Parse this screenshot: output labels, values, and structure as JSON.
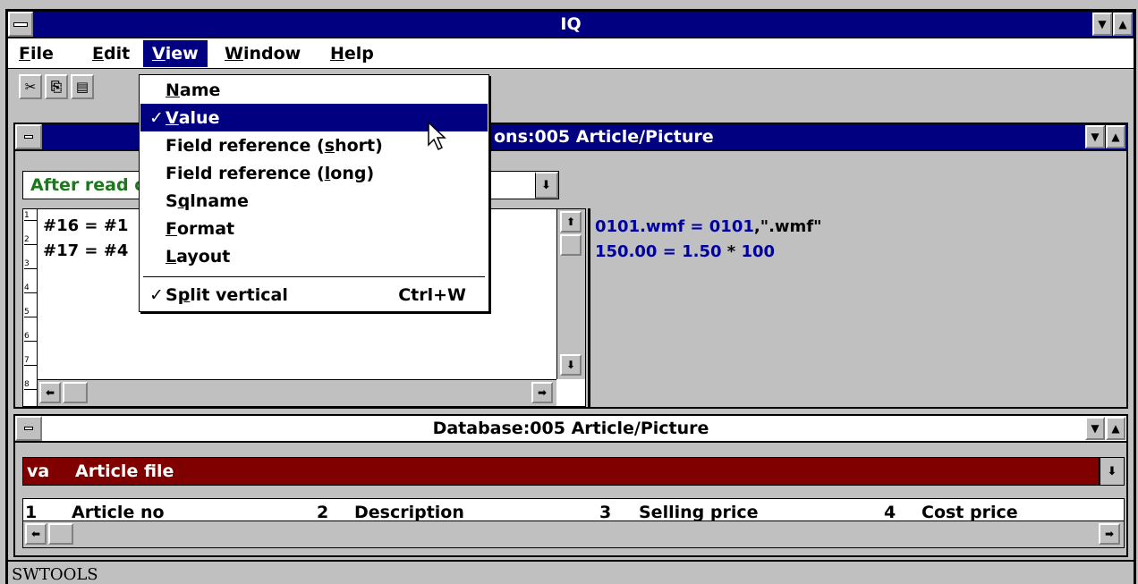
{
  "window": {
    "title": "IQ"
  },
  "menubar": {
    "items": [
      {
        "label": "File",
        "u": "F",
        "rest": "ile"
      },
      {
        "label": "Edit",
        "u": "E",
        "rest": "dit"
      },
      {
        "label": "View",
        "u": "V",
        "rest": "iew"
      },
      {
        "label": "Window",
        "u": "W",
        "rest": "indow"
      },
      {
        "label": "Help",
        "u": "H",
        "rest": "elp"
      }
    ]
  },
  "toolbar": {
    "buttons": [
      {
        "name": "cut-button",
        "icon": "scissors-icon",
        "glyph": "✂"
      },
      {
        "name": "copy-button",
        "icon": "copy-icon",
        "glyph": "⎘"
      },
      {
        "name": "paste-button",
        "icon": "paste-icon",
        "glyph": "📋"
      }
    ]
  },
  "view_menu": {
    "items": [
      {
        "pre": "",
        "u": "N",
        "post": "ame",
        "checked": false,
        "selected": false
      },
      {
        "pre": "",
        "u": "V",
        "post": "alue",
        "checked": true,
        "selected": true
      },
      {
        "pre": "Field reference (",
        "u": "s",
        "post": "hort)",
        "checked": false,
        "selected": false
      },
      {
        "pre": "Field reference (",
        "u": "l",
        "post": "ong)",
        "checked": false,
        "selected": false
      },
      {
        "pre": "S",
        "u": "q",
        "post": "lname",
        "checked": false,
        "selected": false
      },
      {
        "pre": "",
        "u": "F",
        "post": "ormat",
        "checked": false,
        "selected": false
      },
      {
        "pre": "",
        "u": "L",
        "post": "ayout",
        "checked": false,
        "selected": false
      },
      {
        "pre": "S",
        "u": "p",
        "post": "lit vertical",
        "checked": true,
        "selected": false,
        "shortcut": "Ctrl+W"
      }
    ],
    "check_mark": "✓"
  },
  "calc_window": {
    "title_visible": "ons:005  Article/Picture",
    "event_combo": "After read o",
    "code_lines": [
      "#16 = #1",
      "#17 = #4"
    ],
    "line_numbers": [
      "1",
      "2",
      "3",
      "4",
      "5",
      "6",
      "7",
      "8"
    ],
    "value_lines": [
      {
        "a": "0101.wmf = 0101",
        "b": ",\".wmf\""
      },
      {
        "a": "150.00 = 1.50 ",
        "b": "* ",
        "c": "100"
      }
    ]
  },
  "db_window": {
    "title": "Database:005  Article/Picture",
    "file_code": "va",
    "file_name": "Article file",
    "columns": [
      {
        "num": "1",
        "label": "Article no"
      },
      {
        "num": "2",
        "label": "Description"
      },
      {
        "num": "3",
        "label": "Selling price"
      },
      {
        "num": "4",
        "label": "Cost price"
      }
    ]
  },
  "status": {
    "text": "SWTOOLS"
  }
}
